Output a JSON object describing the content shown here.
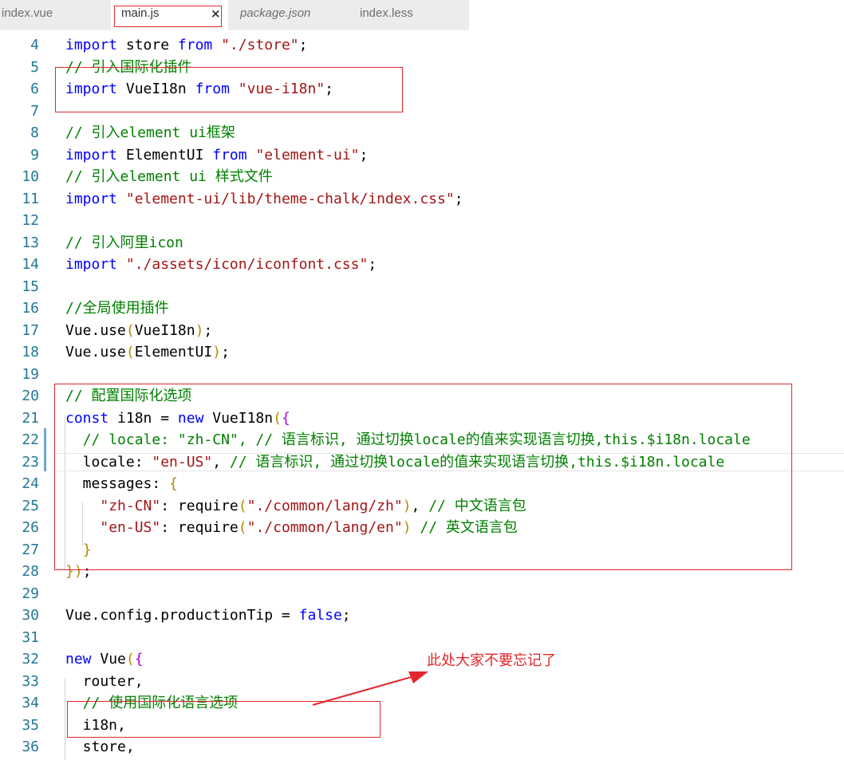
{
  "tabs": [
    {
      "label": "index.vue",
      "active": false,
      "italic": false
    },
    {
      "label": "main.js",
      "active": true,
      "italic": false,
      "close_icon": "×"
    },
    {
      "label": "package.json",
      "active": false,
      "italic": true
    },
    {
      "label": "index.less",
      "active": false,
      "italic": false
    }
  ],
  "lines": [
    {
      "n": "4",
      "code": "import store from \"./store\";"
    },
    {
      "n": "5",
      "code": "// 引入国际化插件"
    },
    {
      "n": "6",
      "code": "import VueI18n from \"vue-i18n\";"
    },
    {
      "n": "7",
      "code": ""
    },
    {
      "n": "8",
      "code": "// 引入element ui框架"
    },
    {
      "n": "9",
      "code": "import ElementUI from \"element-ui\";"
    },
    {
      "n": "10",
      "code": "// 引入element ui 样式文件"
    },
    {
      "n": "11",
      "code": "import \"element-ui/lib/theme-chalk/index.css\";"
    },
    {
      "n": "12",
      "code": ""
    },
    {
      "n": "13",
      "code": "// 引入阿里icon"
    },
    {
      "n": "14",
      "code": "import \"./assets/icon/iconfont.css\";"
    },
    {
      "n": "15",
      "code": ""
    },
    {
      "n": "16",
      "code": "//全局使用插件"
    },
    {
      "n": "17",
      "code": "Vue.use(VueI18n);"
    },
    {
      "n": "18",
      "code": "Vue.use(ElementUI);"
    },
    {
      "n": "19",
      "code": ""
    },
    {
      "n": "20",
      "code": "// 配置国际化选项"
    },
    {
      "n": "21",
      "code": "const i18n = new VueI18n({"
    },
    {
      "n": "22",
      "code": "  // locale: \"zh-CN\", // 语言标识, 通过切换locale的值来实现语言切换,this.$i18n.locale"
    },
    {
      "n": "23",
      "code": "  locale: \"en-US\", // 语言标识, 通过切换locale的值来实现语言切换,this.$i18n.locale"
    },
    {
      "n": "24",
      "code": "  messages: {"
    },
    {
      "n": "25",
      "code": "    \"zh-CN\": require(\"./common/lang/zh\"), // 中文语言包"
    },
    {
      "n": "26",
      "code": "    \"en-US\": require(\"./common/lang/en\") // 英文语言包"
    },
    {
      "n": "27",
      "code": "  }"
    },
    {
      "n": "28",
      "code": "});"
    },
    {
      "n": "29",
      "code": ""
    },
    {
      "n": "30",
      "code": "Vue.config.productionTip = false;"
    },
    {
      "n": "31",
      "code": ""
    },
    {
      "n": "32",
      "code": "new Vue({"
    },
    {
      "n": "33",
      "code": "  router,"
    },
    {
      "n": "34",
      "code": "  // 使用国际化语言选项"
    },
    {
      "n": "35",
      "code": "  i18n,"
    },
    {
      "n": "36",
      "code": "  store,"
    }
  ],
  "current_line": "23",
  "annotation": {
    "text": "此处大家不要忘记了",
    "color": "#e3262b"
  },
  "colors": {
    "keyword": "#0000ff",
    "string": "#a31515",
    "comment": "#008000",
    "line_number": "#237893",
    "highlight_box": "#e3262b"
  }
}
